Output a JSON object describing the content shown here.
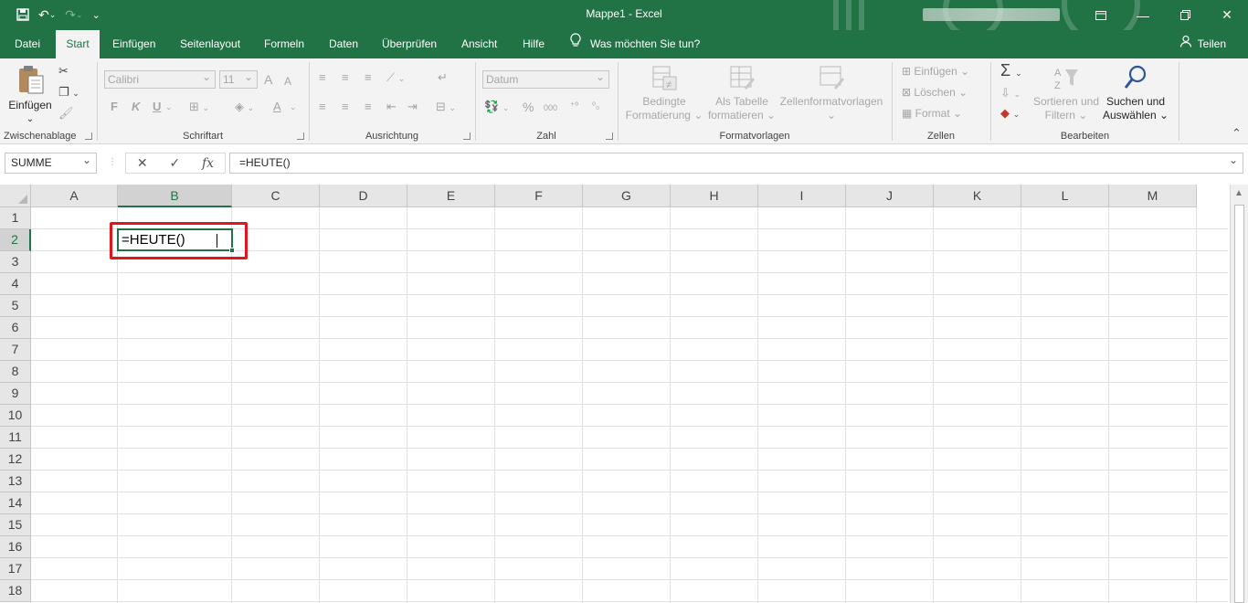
{
  "window": {
    "title": "Mappe1  -  Excel"
  },
  "tabs": [
    {
      "label": "Datei"
    },
    {
      "label": "Start"
    },
    {
      "label": "Einfügen"
    },
    {
      "label": "Seitenlayout"
    },
    {
      "label": "Formeln"
    },
    {
      "label": "Daten"
    },
    {
      "label": "Überprüfen"
    },
    {
      "label": "Ansicht"
    },
    {
      "label": "Hilfe"
    }
  ],
  "tell_me": "Was möchten Sie tun?",
  "share": "Teilen",
  "ribbon": {
    "clipboard": {
      "paste": "Einfügen",
      "label": "Zwischenablage"
    },
    "font": {
      "name": "Calibri",
      "size": "11",
      "bold": "F",
      "italic": "K",
      "underline": "U",
      "grow": "A",
      "shrink": "A",
      "color": "A",
      "label": "Schriftart"
    },
    "alignment": {
      "label": "Ausrichtung"
    },
    "number": {
      "format": "Datum",
      "percent": "%",
      "thousands": "000",
      "label": "Zahl"
    },
    "styles": {
      "conditional": "Bedingte",
      "conditional2": "Formatierung",
      "table": "Als Tabelle",
      "table2": "formatieren",
      "cellstyles": "Zellenformatvorlagen",
      "label": "Formatvorlagen"
    },
    "cells": {
      "insert": "Einfügen",
      "delete": "Löschen",
      "format": "Format",
      "label": "Zellen"
    },
    "editing": {
      "sort": "Sortieren und",
      "sort2": "Filtern",
      "find": "Suchen und",
      "find2": "Auswählen",
      "label": "Bearbeiten"
    }
  },
  "formula_bar": {
    "name_box": "SUMME",
    "cancel": "✕",
    "enter": "✓",
    "fx": "fx",
    "formula": "=HEUTE()"
  },
  "sheet": {
    "columns": [
      "A",
      "B",
      "C",
      "D",
      "E",
      "F",
      "G",
      "H",
      "I",
      "J",
      "K",
      "L",
      "M"
    ],
    "rows": [
      "1",
      "2",
      "3",
      "4",
      "5",
      "6",
      "7",
      "8",
      "9",
      "10",
      "11",
      "12",
      "13",
      "14",
      "15",
      "16",
      "17",
      "18"
    ],
    "active_cell": {
      "ref": "B2",
      "content": "=HEUTE()"
    }
  }
}
